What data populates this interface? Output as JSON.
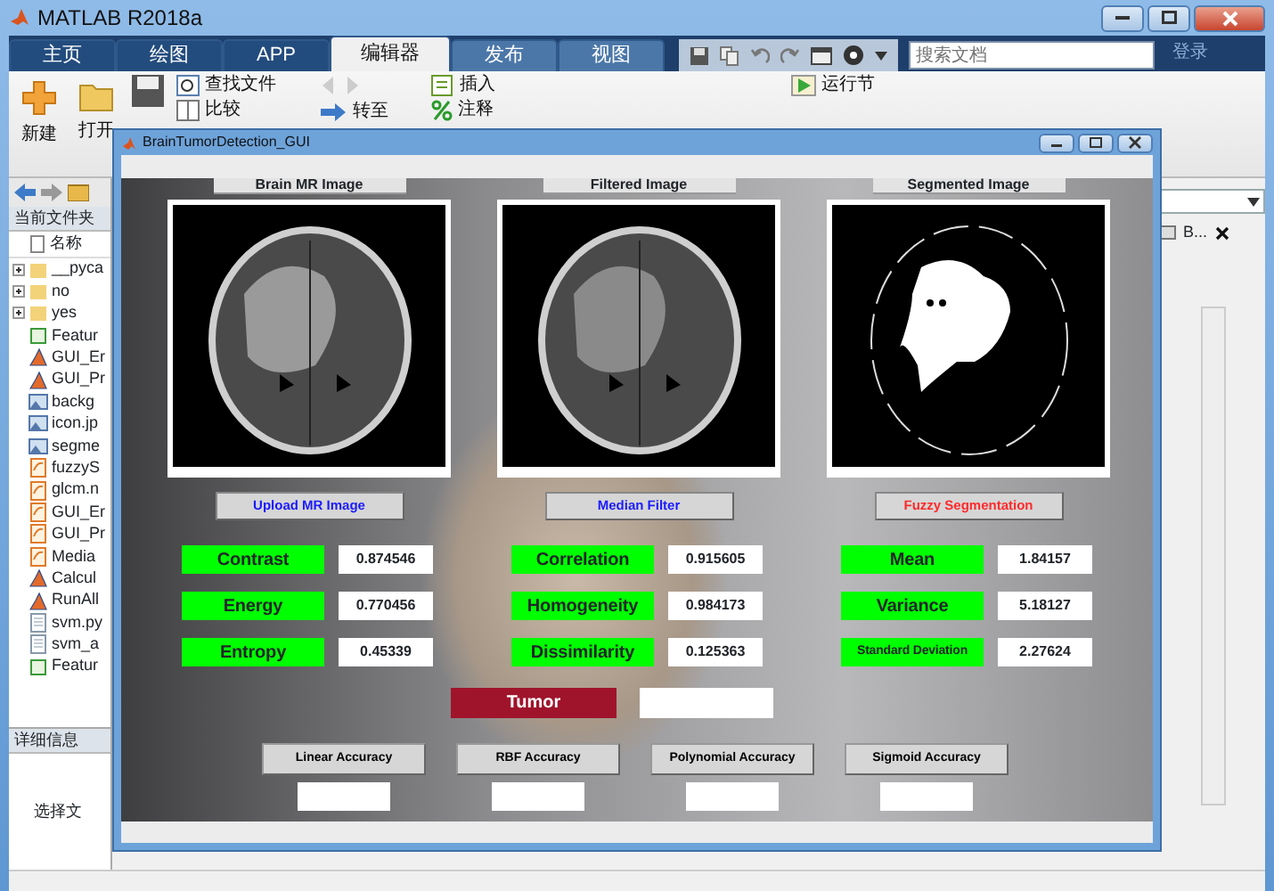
{
  "app": {
    "title": "MATLAB R2018a",
    "tabs": [
      {
        "label": "主页",
        "selected": false
      },
      {
        "label": "绘图",
        "selected": false
      },
      {
        "label": "APP",
        "selected": false
      },
      {
        "label": "编辑器",
        "selected": true
      },
      {
        "label": "发布",
        "selected": false
      },
      {
        "label": "视图",
        "selected": false
      }
    ],
    "search": {
      "placeholder": "搜索文档"
    },
    "login": "登录",
    "toolstrip": {
      "new": "新建",
      "open": "打开",
      "find_files": "查找文件",
      "compare": "比较",
      "go_to": "转至",
      "insert": "插入",
      "comment": "注释",
      "run_section": "运行节"
    }
  },
  "file_browser": {
    "title": "当前文件夹",
    "column": "名称",
    "files": [
      {
        "name": "__pyca",
        "kind": "folder"
      },
      {
        "name": "no",
        "kind": "folder"
      },
      {
        "name": "yes",
        "kind": "folder"
      },
      {
        "name": "Featur",
        "kind": "data"
      },
      {
        "name": "GUI_Er",
        "kind": "fig"
      },
      {
        "name": "GUI_Pr",
        "kind": "fig"
      },
      {
        "name": "backg",
        "kind": "image"
      },
      {
        "name": "icon.jp",
        "kind": "image"
      },
      {
        "name": "segme",
        "kind": "image"
      },
      {
        "name": "fuzzyS",
        "kind": "script"
      },
      {
        "name": "glcm.n",
        "kind": "script"
      },
      {
        "name": "GUI_Er",
        "kind": "script"
      },
      {
        "name": "GUI_Pr",
        "kind": "script"
      },
      {
        "name": "Media",
        "kind": "script"
      },
      {
        "name": "Calcul",
        "kind": "fig"
      },
      {
        "name": "RunAll",
        "kind": "fig"
      },
      {
        "name": "svm.py",
        "kind": "text"
      },
      {
        "name": "svm_a",
        "kind": "text"
      },
      {
        "name": "Featur",
        "kind": "data"
      }
    ],
    "details_title": "详细信息",
    "details_text": "选择文"
  },
  "path_tail": "B...",
  "figure": {
    "title": "BrainTumorDetection_GUI",
    "panels": [
      {
        "title": "Brain MR Image",
        "button": {
          "label": "Upload MR Image",
          "color": "#1a1aff"
        },
        "features": [
          {
            "label": "Contrast",
            "value": "0.874546"
          },
          {
            "label": "Energy",
            "value": "0.770456"
          },
          {
            "label": "Entropy",
            "value": "0.45339"
          }
        ]
      },
      {
        "title": "Filtered Image",
        "button": {
          "label": "Median Filter",
          "color": "#1a1aff"
        },
        "features": [
          {
            "label": "Correlation",
            "value": "0.915605"
          },
          {
            "label": "Homogeneity",
            "value": "0.984173"
          },
          {
            "label": "Dissimilarity",
            "value": "0.125363"
          }
        ]
      },
      {
        "title": "Segmented Image",
        "button": {
          "label": "Fuzzy Segmentation",
          "color": "#ff2a2a"
        },
        "features": [
          {
            "label": "Mean",
            "value": "1.84157"
          },
          {
            "label": "Variance",
            "value": "5.18127"
          },
          {
            "label": "Standard Deviation",
            "value": "2.27624"
          }
        ]
      }
    ],
    "result": {
      "label": "Tumor"
    },
    "accuracy": [
      {
        "label": "Linear Accuracy"
      },
      {
        "label": "RBF Accuracy"
      },
      {
        "label": "Polynomial Accuracy"
      },
      {
        "label": "Sigmoid Accuracy"
      }
    ]
  }
}
